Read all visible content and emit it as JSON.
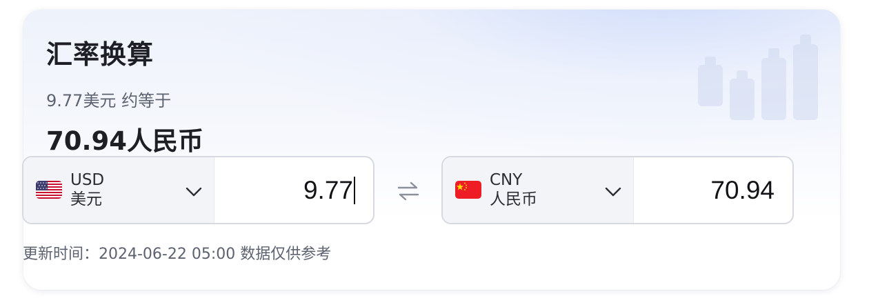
{
  "card": {
    "title": "汇率换算",
    "equivalent_text": "9.77美元 约等于",
    "result_text": "70.94人民币"
  },
  "from": {
    "code": "USD",
    "name": "美元",
    "flag_icon": "us-flag-icon",
    "amount": "9.77"
  },
  "to": {
    "code": "CNY",
    "name": "人民币",
    "flag_icon": "cn-flag-icon",
    "amount": "70.94"
  },
  "swap_icon": "swap-arrows-icon",
  "footer": {
    "update_text": "更新时间：2024-06-22 05:00 数据仅供参考"
  },
  "colors": {
    "title": "#1d1f24",
    "muted_text": "#5d6270",
    "border": "#d6d9e0",
    "select_bg": "#f3f4f8",
    "cn_flag_red": "#ee1c25",
    "cn_flag_star": "#ffde00"
  }
}
